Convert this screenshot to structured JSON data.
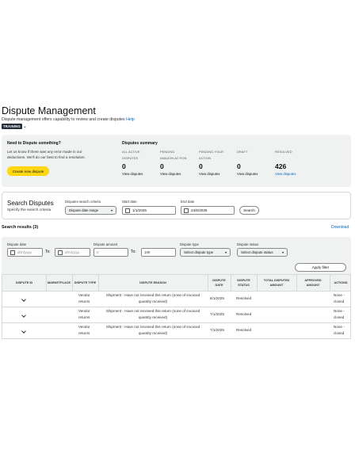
{
  "header": {
    "title": "Dispute Management",
    "subtitle": "Dispute management offers capability to review and create disputes",
    "help_link": "Help",
    "training_badge": "TRAINING"
  },
  "need_dispute": {
    "heading": "Need to Dispute something?",
    "body_line1": "Let us know if there was any error made in our",
    "body_line2": "deductions. We'll do our best to find a resolution.",
    "create_button": "Create new dispute"
  },
  "summary": {
    "heading": "Disputes summary",
    "cards": [
      {
        "label1": "ALL ACTIVE",
        "label2": "DISPUTES",
        "value": "0",
        "link": "View disputes"
      },
      {
        "label1": "PENDING",
        "label2": "AMAZON ACTION",
        "value": "0",
        "link": "View disputes"
      },
      {
        "label1": "PENDING YOUR",
        "label2": "ACTION",
        "value": "0",
        "link": "View disputes"
      },
      {
        "label1": "DRAFT",
        "label2": "",
        "value": "0",
        "link": "View disputes"
      },
      {
        "label1": "RESOLVED",
        "label2": "",
        "value": "426",
        "link": "View disputes"
      }
    ]
  },
  "search": {
    "heading": "Search Disputes",
    "subheading": "Specify the search criteria",
    "criteria_label": "Disputes search criteria",
    "criteria_value": "Dispute date range",
    "start_label": "Start date",
    "start_value": "1/1/2025",
    "end_label": "End date",
    "end_value": "24/6/2025",
    "search_button": "Search"
  },
  "results": {
    "title": "Search results (3)",
    "download": "Download"
  },
  "filters": {
    "dispute_date_label": "Dispute date",
    "date_placeholder": "d/m/yyyy",
    "to_label": "To:",
    "amount_label": "Dispute amount",
    "amount_from": "0",
    "amount_to": "100",
    "type_label": "Dispute type",
    "type_placeholder": "Select dispute type",
    "status_label": "Dispute status",
    "status_placeholder": "Select dispute status",
    "apply_button": "Apply filter"
  },
  "table": {
    "headers": [
      "DISPUTE ID",
      "MARKETPLACE",
      "DISPUTE TYPE",
      "DISPUTE REASON",
      "DISPUTE DATE",
      "DISPUTE STATUS",
      "TOTAL DISPUTED AMOUNT",
      "APPROVED AMOUNT",
      "ACTIONS"
    ],
    "rows": [
      {
        "type1": "Vendor",
        "type2": "returns",
        "reason1": "Shipment - Have not received this return (none of invoiced",
        "reason2": "quantity received)",
        "date": "8/1/2025",
        "status": "Resolved",
        "actions1": "None -",
        "actions2": "closed"
      },
      {
        "type1": "Vendor",
        "type2": "returns",
        "reason1": "Shipment - Have not received this return (none of invoiced",
        "reason2": "quantity received)",
        "date": "7/1/2025",
        "status": "Resolved",
        "actions1": "None -",
        "actions2": "closed"
      },
      {
        "type1": "Vendor",
        "type2": "returns",
        "reason1": "Shipment - Have not received this return (none of invoiced",
        "reason2": "quantity received)",
        "date": "7/1/2025",
        "status": "Resolved",
        "actions1": "None -",
        "actions2": "closed"
      }
    ]
  }
}
